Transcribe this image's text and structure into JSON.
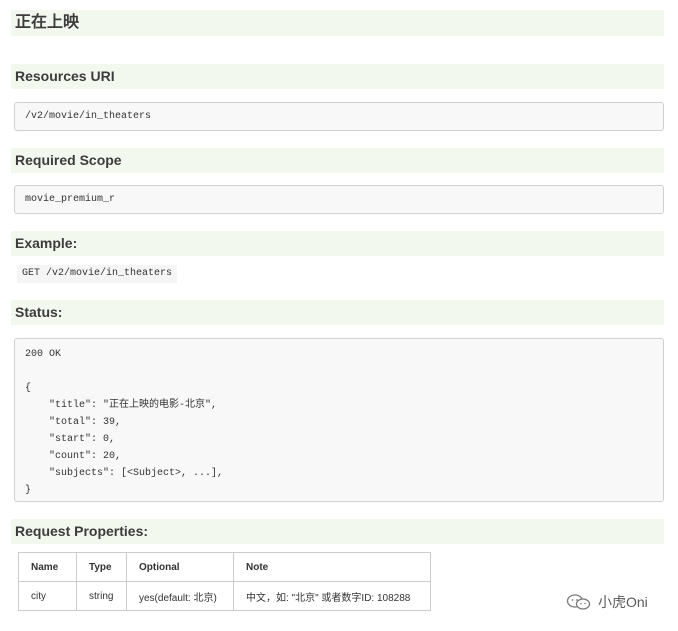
{
  "page_title": "正在上映",
  "sections": {
    "resources_uri": {
      "heading": "Resources URI",
      "value": "/v2/movie/in_theaters"
    },
    "required_scope": {
      "heading": "Required Scope",
      "value": "movie_premium_r"
    },
    "example": {
      "heading": "Example:",
      "value": "GET /v2/movie/in_theaters"
    },
    "status": {
      "heading": "Status:",
      "lines": [
        "200 OK",
        "",
        "{",
        "    \"title\": \"正在上映的电影-北京\",",
        "    \"total\": 39,",
        "    \"start\": 0,",
        "    \"count\": 20,",
        "    \"subjects\": [<Subject>, ...],",
        "}"
      ]
    },
    "request_properties": {
      "heading": "Request Properties:",
      "columns": [
        "Name",
        "Type",
        "Optional",
        "Note"
      ],
      "rows": [
        [
          "city",
          "string",
          "yes(default: 北京)",
          "中文，如: \"北京\" 或者数字ID: 108288"
        ]
      ]
    }
  },
  "watermark": {
    "text": "小虎Oni",
    "icon": "wechat-icon"
  }
}
